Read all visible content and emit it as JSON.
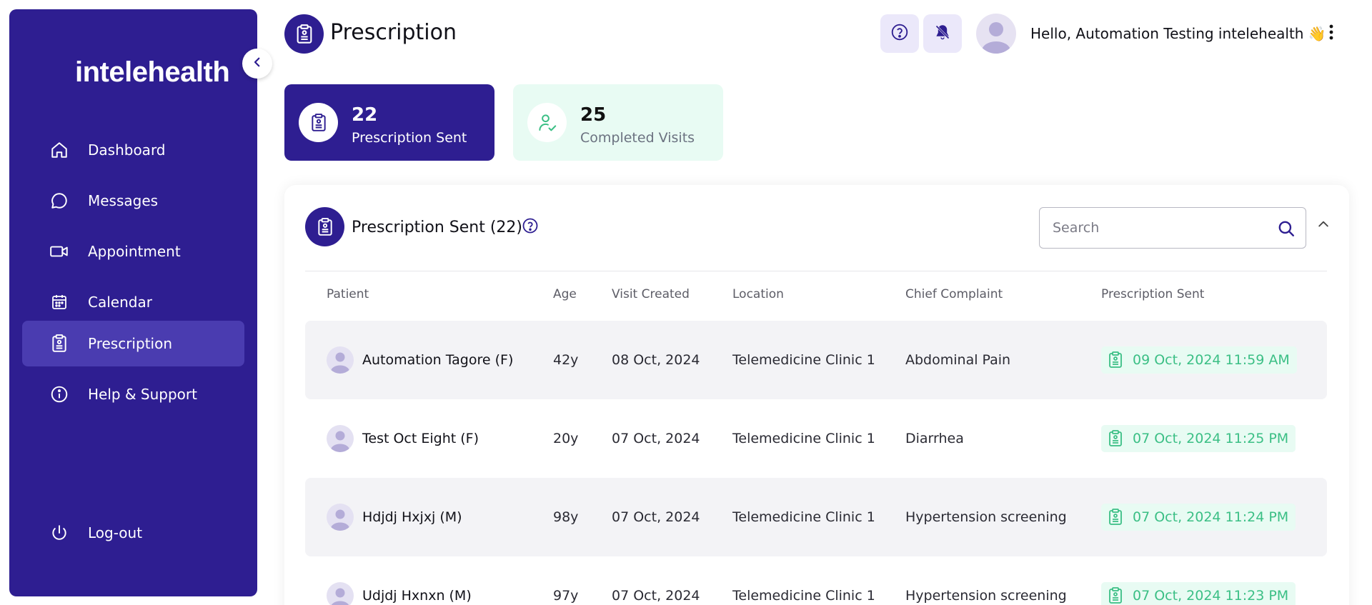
{
  "brand": {
    "logo_text": "intelehealth"
  },
  "sidebar": {
    "items": [
      {
        "label": "Dashboard",
        "icon": "home-icon"
      },
      {
        "label": "Messages",
        "icon": "chat-icon"
      },
      {
        "label": "Appointment",
        "icon": "video-icon"
      },
      {
        "label": "Calendar",
        "icon": "calendar-icon"
      },
      {
        "label": "Prescription",
        "icon": "clipboard-icon",
        "active": true
      },
      {
        "label": "Help & Support",
        "icon": "info-icon"
      }
    ],
    "logout": {
      "label": "Log-out",
      "icon": "power-icon"
    }
  },
  "header": {
    "title": "Prescription",
    "greeting": "Hello, Automation Testing intelehealth 👋"
  },
  "stats": [
    {
      "value": "22",
      "label": "Prescription Sent"
    },
    {
      "value": "25",
      "label": "Completed Visits"
    }
  ],
  "panel": {
    "title": "Prescription Sent (22)",
    "search_placeholder": "Search",
    "columns": [
      "Patient",
      "Age",
      "Visit Created",
      "Location",
      "Chief Complaint",
      "Prescription Sent"
    ],
    "rows": [
      {
        "patient": "Automation Tagore (F)",
        "age": "42y",
        "visit_created": "08 Oct, 2024",
        "location": "Telemedicine Clinic 1",
        "complaint": "Abdominal Pain",
        "sent": "09 Oct, 2024 11:59 AM"
      },
      {
        "patient": "Test Oct Eight (F)",
        "age": "20y",
        "visit_created": "07 Oct, 2024",
        "location": "Telemedicine Clinic 1",
        "complaint": "Diarrhea",
        "sent": "07 Oct, 2024 11:25 PM"
      },
      {
        "patient": "Hdjdj Hxjxj (M)",
        "age": "98y",
        "visit_created": "07 Oct, 2024",
        "location": "Telemedicine Clinic 1",
        "complaint": "Hypertension screening",
        "sent": "07 Oct, 2024 11:24 PM"
      },
      {
        "patient": "Udjdj Hxnxn (M)",
        "age": "97y",
        "visit_created": "07 Oct, 2024",
        "location": "Telemedicine Clinic 1",
        "complaint": "Hypertension screening",
        "sent": "07 Oct, 2024 11:23 PM"
      }
    ]
  },
  "colors": {
    "primary": "#2e1e91",
    "active_nav": "#4a3cb0",
    "success": "#3bbf85",
    "success_bg": "#e8fbf3"
  }
}
